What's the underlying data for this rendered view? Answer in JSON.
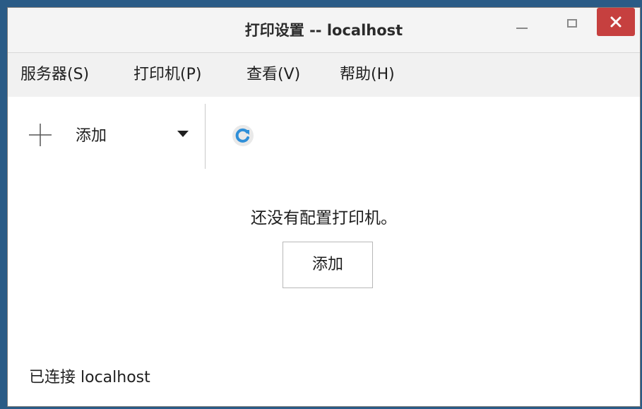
{
  "window": {
    "title": "打印设置 -- localhost"
  },
  "menubar": {
    "items": [
      {
        "label": "服务器(S)"
      },
      {
        "label": "打印机(P)"
      },
      {
        "label": "查看(V)"
      },
      {
        "label": "帮助(H)"
      }
    ]
  },
  "toolbar": {
    "add_label": "添加",
    "add_icon": "plus-icon",
    "dropdown_icon": "dropdown-arrow-icon",
    "refresh_icon": "refresh-icon"
  },
  "main": {
    "empty_message": "还没有配置打印机。",
    "add_button_label": "添加"
  },
  "status": {
    "text": "已连接 localhost"
  },
  "colors": {
    "close_button": "#c6403f",
    "refresh_accent": "#2f8fd8",
    "desktop": "#2a5b86"
  }
}
